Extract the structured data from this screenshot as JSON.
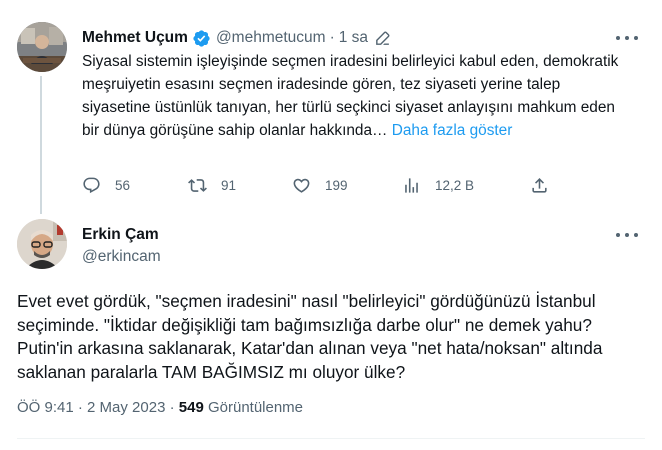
{
  "parent_tweet": {
    "display_name": "Mehmet Uçum",
    "handle": "@mehmetucum",
    "separator": "·",
    "time": "1 sa",
    "text": "Siyasal sistemin işleyişinde seçmen iradesini belirleyici kabul eden, demokratik meşruiyetin esasını seçmen iradesinde gören, tez siyaseti yerine talep siyasetine üstünlük tanıyan, her türlü seçkinci siyaset anlayışını mahkum eden bir dünya görüşüne sahip olanlar hakkında…",
    "show_more": "Daha fazla göster",
    "metrics": {
      "replies": "56",
      "retweets": "91",
      "likes": "199",
      "views": "12,2 B"
    }
  },
  "main_tweet": {
    "display_name": "Erkin Çam",
    "handle": "@erkincam",
    "text": "Evet evet gördük, \"seçmen iradesini\" nasıl \"belirleyici\" gördüğünüzü İstanbul seçiminde. \"İktidar değişikliği tam bağımsızlığa darbe olur\" ne demek yahu? Putin'in arkasına saklanarak, Katar'dan alınan veya \"net hata/noksan\" altında saklanan paralarla TAM BAĞIMSIZ mı oluyor ülke?",
    "timestamp": "ÖÖ 9:41 · 2 May 2023",
    "meta_separator": "·",
    "views_count": "549",
    "views_label": "Görüntülenme"
  },
  "icons": {
    "verified": "verified-badge-icon",
    "edited": "pencil-icon",
    "more": "more-horizontal-icon",
    "reply": "reply-icon",
    "retweet": "retweet-icon",
    "like": "heart-icon",
    "views": "analytics-icon",
    "share": "share-icon"
  },
  "colors": {
    "text": "#0f1419",
    "secondary": "#536471",
    "link": "#1d9bf0",
    "verified": "#1d9bf0",
    "thread_line": "#cfd9de"
  }
}
